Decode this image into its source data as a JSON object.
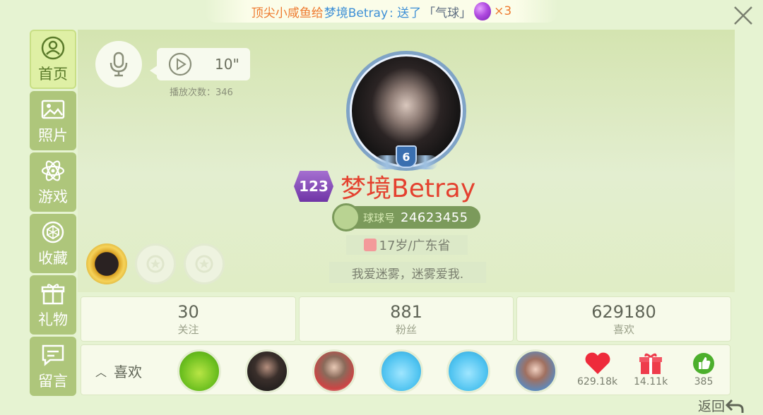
{
  "banner": {
    "sender": "顶尖小咸鱼",
    "connector": "给",
    "receiver": "梦境Betray",
    "action": ":  送了",
    "gift": "「气球」",
    "count": "×3"
  },
  "sidebar": {
    "items": [
      {
        "label": "首页",
        "icon": "home-icon",
        "active": true
      },
      {
        "label": "照片",
        "icon": "photo-icon",
        "active": false
      },
      {
        "label": "游戏",
        "icon": "game-icon",
        "active": false
      },
      {
        "label": "收藏",
        "icon": "collection-icon",
        "active": false
      },
      {
        "label": "礼物",
        "icon": "gift-icon",
        "active": false
      },
      {
        "label": "留言",
        "icon": "message-icon",
        "active": false
      }
    ]
  },
  "voice": {
    "duration": "10\"",
    "play_count": "播放次数：346"
  },
  "profile": {
    "avatar_level": "6",
    "user_level": "123",
    "username": "梦境Betray",
    "id_label": "球球号",
    "id_value": "24623455",
    "age_location": "17岁/广东省",
    "bio": "我爱迷雾，迷雾爱我."
  },
  "stats": [
    {
      "value": "30",
      "label": "关注"
    },
    {
      "value": "881",
      "label": "粉丝"
    },
    {
      "value": "629180",
      "label": "喜欢"
    }
  ],
  "likes": {
    "toggle_label": "喜欢",
    "heart_count": "629.18k",
    "gift_count": "14.11k",
    "thumb_count": "385"
  },
  "nav": {
    "back_label": "返回"
  },
  "colors": {
    "accent_green": "#aec67b",
    "username_red": "#e4412f",
    "banner_orange": "#ee7a2f",
    "banner_blue": "#3d8fd6"
  }
}
